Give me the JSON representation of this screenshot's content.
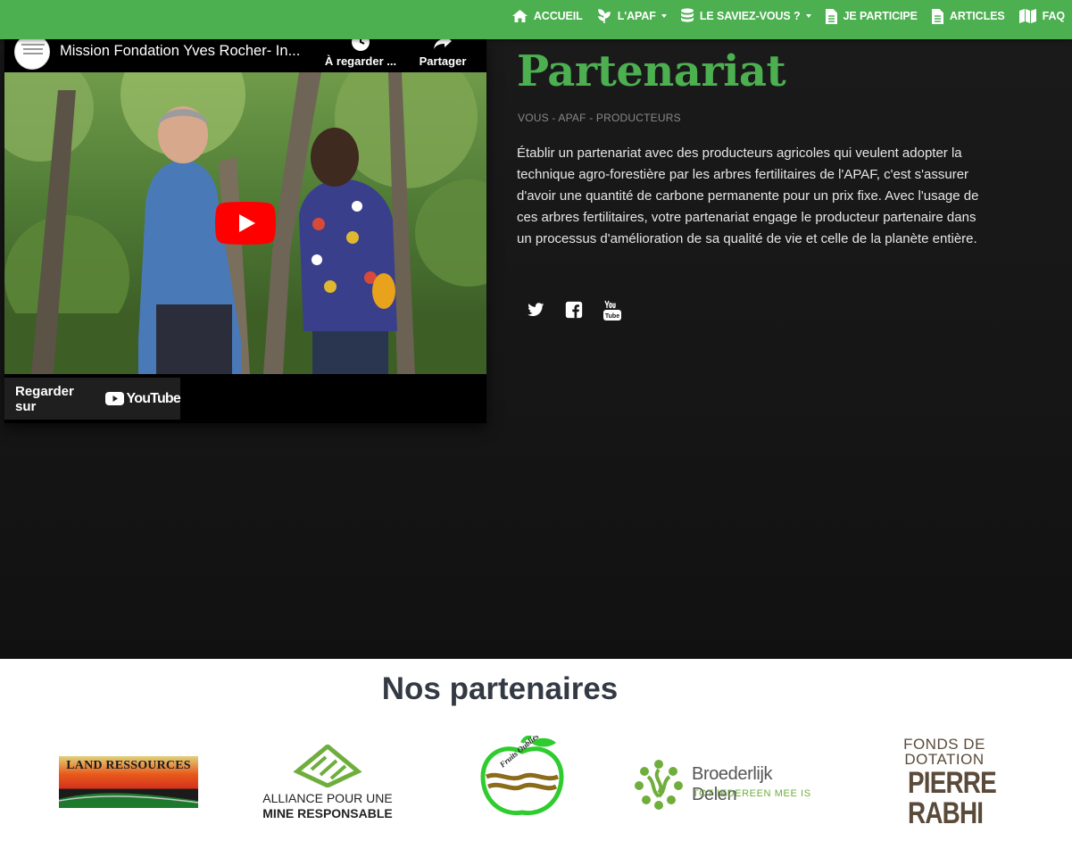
{
  "nav": {
    "items": [
      {
        "label": "ACCUEIL",
        "icon": "home-icon",
        "dropdown": false
      },
      {
        "label": "L'APAF",
        "icon": "leaf-icon",
        "dropdown": true
      },
      {
        "label": "LE SAVIEZ-VOUS ?",
        "icon": "database-icon",
        "dropdown": true
      },
      {
        "label": "JE PARTICIPE",
        "icon": "document-icon",
        "dropdown": false
      },
      {
        "label": "ARTICLES",
        "icon": "document-icon",
        "dropdown": false
      },
      {
        "label": "FAQ",
        "icon": "map-icon",
        "dropdown": false
      }
    ]
  },
  "video": {
    "title": "Mission Fondation Yves Rocher- In...",
    "watch_later": "À regarder ...",
    "share": "Partager",
    "watch_on": "Regarder sur",
    "youtube": "YouTube"
  },
  "main": {
    "title": "Partenariat",
    "subtitle": "VOUS - APAF - PRODUCTEURS",
    "intro": "Établir un partenariat avec des producteurs agricoles qui veulent adopter la technique agro-forestière par les arbres fertilitaires de l'APAF, c'est s'assurer d'avoir une quantité de carbone permanente pour un prix fixe. Avec l'usage de ces arbres fertilitaires, votre partenariat engage le producteur partenaire dans un processus d'amélioration de sa qualité de vie et celle de la planète entière.",
    "social": [
      "twitter-icon",
      "facebook-icon",
      "youtube-icon"
    ]
  },
  "partners": {
    "title": "Nos partenaires",
    "land": "LAND RESSOURCES",
    "alliance_line1": "ALLIANCE POUR UNE",
    "alliance_line2": "MINE RESPONSABLE",
    "fruits": "Fruits Oubliés Réseau",
    "broeder_name": "Broederlijk Delen",
    "broeder_tag": "TOT IEDEREEN MEE IS",
    "pierre_l1": "FONDS DE",
    "pierre_l2": "DOTATION",
    "pierre_l3": "PIERRE",
    "pierre_l4": "RABHI"
  },
  "colors": {
    "brand_green": "#4caf50",
    "hero_background": "#161616",
    "youtube_red": "#ff0000"
  }
}
